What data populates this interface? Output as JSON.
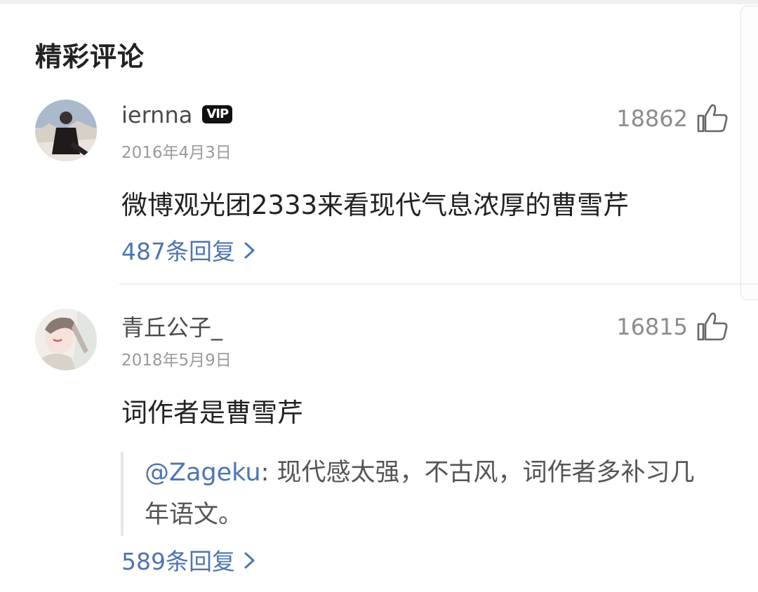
{
  "section": {
    "title": "精彩评论"
  },
  "comments": [
    {
      "username": "iernna",
      "badge": "VIP",
      "date": "2016年4月3日",
      "likes": "18862",
      "text": "微博观光团2333来看现代气息浓厚的曹雪芹",
      "replies": "487条回复"
    },
    {
      "username": "青丘公子_",
      "date": "2018年5月9日",
      "likes": "16815",
      "text": "词作者是曹雪芹",
      "quote": {
        "mention": "@Zageku",
        "line1": ": 现代感太强，不古风，词作者多补习几",
        "line2": "年语文。"
      },
      "replies": "589条回复"
    }
  ],
  "colors": {
    "link": "#4e75b0",
    "muted": "#9a9a9a"
  },
  "icons": {
    "like": "thumbs-up-icon",
    "chevron": "chevron-right-icon"
  }
}
